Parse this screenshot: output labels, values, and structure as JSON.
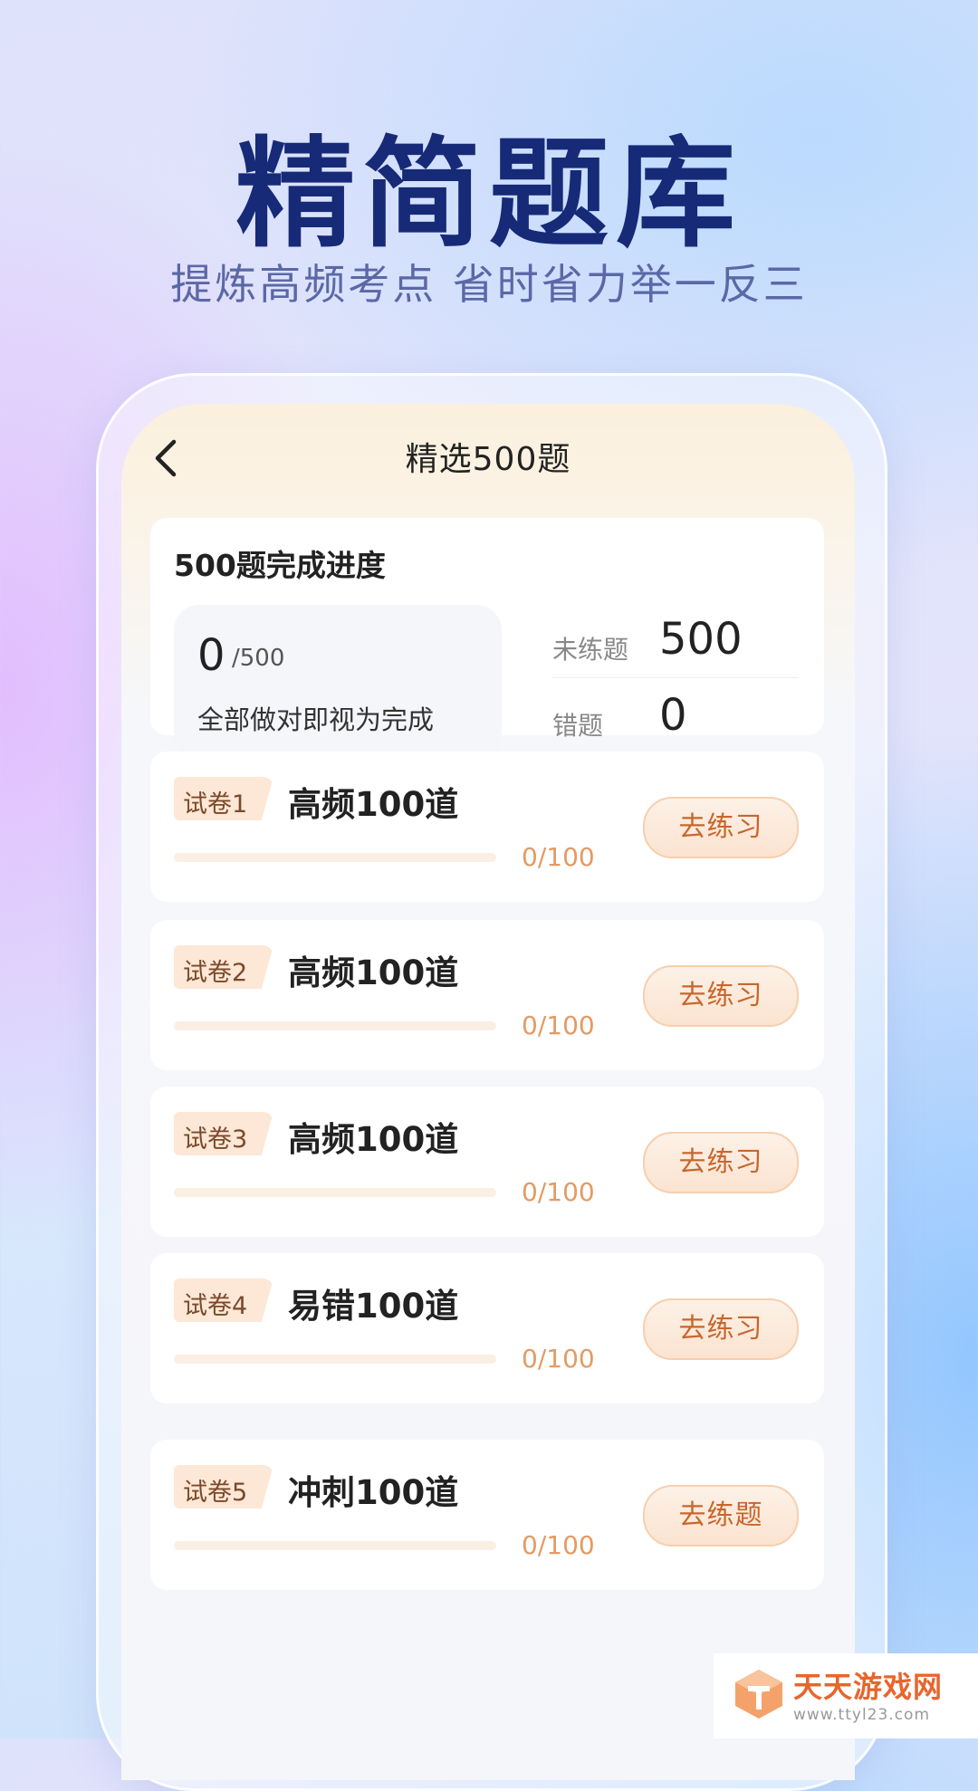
{
  "hero": {
    "title": "精简题库",
    "subtitle": "提炼高频考点  省时省力举一反三"
  },
  "nav": {
    "back_icon": "chevron-left-icon",
    "title": "精选500题"
  },
  "progress": {
    "title": "500题完成进度",
    "completed": "0",
    "total": "/500",
    "note": "全部做对即视为完成",
    "unpracticed_label": "未练题",
    "unpracticed_value": "500",
    "wrong_label": "错题",
    "wrong_value": "0"
  },
  "papers": [
    {
      "tag": "试卷1",
      "name": "高频100道",
      "progress_text": "0/100",
      "progress": 0,
      "button": "去练习"
    },
    {
      "tag": "试卷2",
      "name": "高频100道",
      "progress_text": "0/100",
      "progress": 0,
      "button": "去练习"
    },
    {
      "tag": "试卷3",
      "name": "高频100道",
      "progress_text": "0/100",
      "progress": 0,
      "button": "去练习"
    },
    {
      "tag": "试卷4",
      "name": "易错100道",
      "progress_text": "0/100",
      "progress": 0,
      "button": "去练习"
    },
    {
      "tag": "试卷5",
      "name": "冲刺100道",
      "progress_text": "0/100",
      "progress": 0,
      "button": "去练题"
    }
  ],
  "watermark": {
    "name": "天天游戏网",
    "url": "www.ttyl23.com"
  },
  "colors": {
    "hero_title": "#172a78",
    "accent": "#c8662d",
    "progress_text": "#e39b64"
  }
}
